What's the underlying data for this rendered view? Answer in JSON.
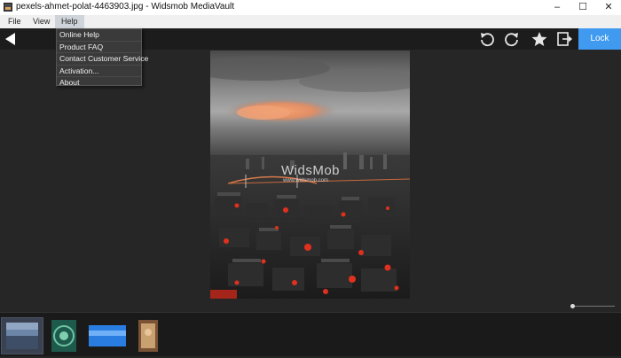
{
  "window": {
    "title": "pexels-ahmet-polat-4463903.jpg - Widsmob MediaVault",
    "minimize": "–",
    "maximize": "☐",
    "close": "✕"
  },
  "menubar": {
    "items": [
      {
        "label": "File"
      },
      {
        "label": "View"
      },
      {
        "label": "Help",
        "active": true
      }
    ]
  },
  "help_menu": {
    "items": [
      {
        "label": "Online Help"
      },
      {
        "label": "Product FAQ"
      },
      {
        "label": "Contact Customer Service"
      },
      {
        "label": "Activation..."
      },
      {
        "label": "About"
      }
    ]
  },
  "toolbar": {
    "back_icon": "back-arrow-icon",
    "rotate_left_icon": "rotate-left-icon",
    "rotate_right_icon": "rotate-right-icon",
    "favorite_icon": "star-icon",
    "export_icon": "export-icon",
    "lock_label": "Lock"
  },
  "viewer": {
    "watermark": "WidsMob",
    "watermark_sub": "www.widsmob.com",
    "zoom_level": 0
  },
  "filmstrip": {
    "thumbnails": [
      {
        "name": "thumb-city",
        "selected": true
      },
      {
        "name": "thumb-mandala",
        "selected": false
      },
      {
        "name": "thumb-water",
        "selected": false
      },
      {
        "name": "thumb-portrait",
        "selected": false
      }
    ]
  },
  "colors": {
    "accent": "#3f9af0",
    "background": "#262626",
    "toolbar": "#1c1c1c"
  }
}
